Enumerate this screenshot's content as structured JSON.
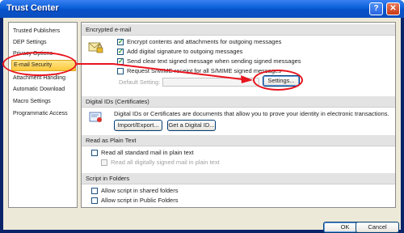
{
  "window": {
    "title": "Trust Center",
    "help_label": "?",
    "close_label": "✕"
  },
  "sidebar": {
    "items": [
      {
        "label": "Trusted Publishers"
      },
      {
        "label": "DEP Settings"
      },
      {
        "label": "Privacy Options"
      },
      {
        "label": "E-mail Security"
      },
      {
        "label": "Attachment Handling"
      },
      {
        "label": "Automatic Download"
      },
      {
        "label": "Macro Settings"
      },
      {
        "label": "Programmatic Access"
      }
    ],
    "selected": "E-mail Security"
  },
  "encrypted": {
    "header": "Encrypted e-mail",
    "options": [
      {
        "label": "Encrypt contents and attachments for outgoing messages",
        "checked": true
      },
      {
        "label": "Add digital signature to outgoing messages",
        "checked": true
      },
      {
        "label": "Send clear text signed message when sending signed messages",
        "checked": true
      },
      {
        "label": "Request S/MIME receipt for all S/MIME signed messages",
        "checked": false
      }
    ],
    "default_setting_label": "Default Setting:",
    "default_setting_value": "",
    "settings_button": "Settings..."
  },
  "digital_ids": {
    "header": "Digital IDs (Certificates)",
    "description": "Digital IDs or Certificates are documents that allow you to prove your identity in electronic transactions.",
    "import_export_button": "Import/Export...",
    "get_id_button": "Get a Digital ID..."
  },
  "plain_text": {
    "header": "Read as Plain Text",
    "options": [
      {
        "label": "Read all standard mail in plain text",
        "checked": false,
        "disabled": false
      },
      {
        "label": "Read all digitally signed mail in plain text",
        "checked": false,
        "disabled": true
      }
    ]
  },
  "script_folders": {
    "header": "Script in Folders",
    "options": [
      {
        "label": "Allow script in shared folders",
        "checked": false
      },
      {
        "label": "Allow script in Public Folders",
        "checked": false
      }
    ]
  },
  "footer": {
    "ok_button": "OK",
    "cancel_button": "Cancel"
  },
  "colors": {
    "highlight_annotation": "#e8141e",
    "selected_item": "#ffc93a",
    "title_bar": "#0a5fd8"
  }
}
